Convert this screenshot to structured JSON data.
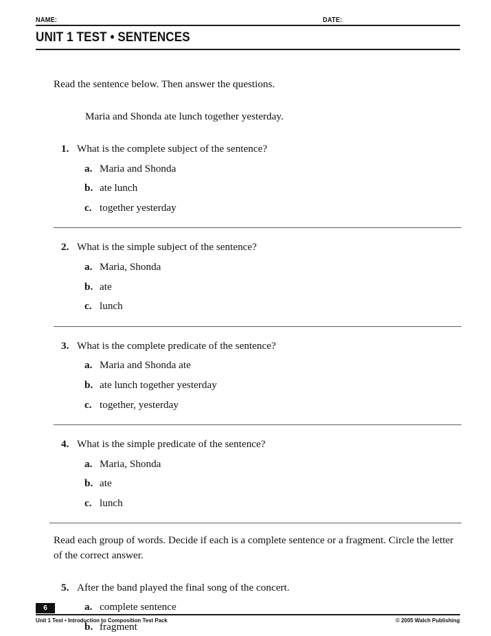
{
  "header": {
    "name_label": "NAME:",
    "date_label": "DATE:",
    "title": "UNIT 1 TEST • SENTENCES"
  },
  "body": {
    "intro_1": "Read the sentence below. Then answer the questions.",
    "example_sentence": "Maria and Shonda ate lunch together yesterday.",
    "intro_2": "Read each group of words. Decide if each is a complete sentence or a fragment. Circle the letter of the correct answer.",
    "questions": [
      {
        "number": "1.",
        "prompt": "What is the complete subject of the sentence?",
        "choices": [
          {
            "letter": "a.",
            "text": "Maria and Shonda"
          },
          {
            "letter": "b.",
            "text": "ate lunch"
          },
          {
            "letter": "c.",
            "text": "together yesterday"
          }
        ]
      },
      {
        "number": "2.",
        "prompt": "What is the simple subject of the sentence?",
        "choices": [
          {
            "letter": "a.",
            "text": "Maria, Shonda"
          },
          {
            "letter": "b.",
            "text": "ate"
          },
          {
            "letter": "c.",
            "text": "lunch"
          }
        ]
      },
      {
        "number": "3.",
        "prompt": "What is the complete predicate of the sentence?",
        "choices": [
          {
            "letter": "a.",
            "text": "Maria and Shonda ate"
          },
          {
            "letter": "b.",
            "text": "ate lunch together yesterday"
          },
          {
            "letter": "c.",
            "text": "together, yesterday"
          }
        ]
      },
      {
        "number": "4.",
        "prompt": "What is the simple predicate of the sentence?",
        "choices": [
          {
            "letter": "a.",
            "text": "Maria, Shonda"
          },
          {
            "letter": "b.",
            "text": "ate"
          },
          {
            "letter": "c.",
            "text": "lunch"
          }
        ]
      },
      {
        "number": "5.",
        "prompt": "After the band played the final song of the concert.",
        "choices": [
          {
            "letter": "a.",
            "text": "complete sentence"
          },
          {
            "letter": "b.",
            "text": "fragment"
          }
        ]
      }
    ]
  },
  "footer": {
    "page_number": "6",
    "left_text": "Unit 1 Test • Introduction to Composition Test Pack",
    "copyright": "© 2005 Walch Publishing"
  }
}
